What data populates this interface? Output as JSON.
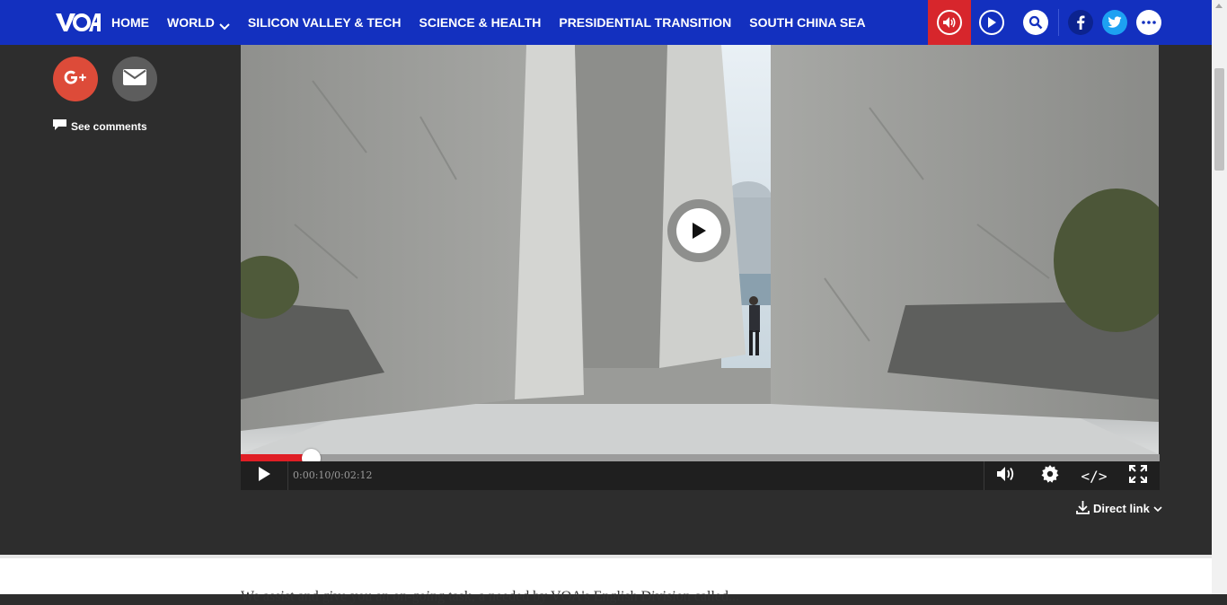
{
  "header": {
    "logo_text": "VOA",
    "nav": [
      {
        "label": "HOME"
      },
      {
        "label": "WORLD",
        "has_dropdown": true
      },
      {
        "label": "SILICON VALLEY & TECH"
      },
      {
        "label": "SCIENCE & HEALTH"
      },
      {
        "label": "PRESIDENTIAL TRANSITION"
      },
      {
        "label": "SOUTH CHINA SEA"
      }
    ],
    "icons": [
      "audio-icon",
      "video-icon",
      "search-icon",
      "facebook-icon",
      "twitter-icon",
      "more-icon"
    ],
    "colors": {
      "nav_bg": "#1330bf",
      "audio_bg": "#d7262c"
    }
  },
  "share": {
    "icons": [
      "google-plus-icon",
      "email-icon"
    ],
    "comments_label": "See comments"
  },
  "player": {
    "current_time": "0:00:10",
    "duration": "0:02:12",
    "time_display": "0:00:10/0:02:12",
    "progress": 0.076,
    "controls": [
      "play-icon",
      "volume-icon",
      "settings-icon",
      "embed-icon",
      "fullscreen-icon"
    ],
    "embed_glyph": "</>",
    "direct_link_label": "Direct link"
  },
  "article": {
    "first_line": "We assist and give you an on-going task, a needed by VOA's English Division called..."
  }
}
